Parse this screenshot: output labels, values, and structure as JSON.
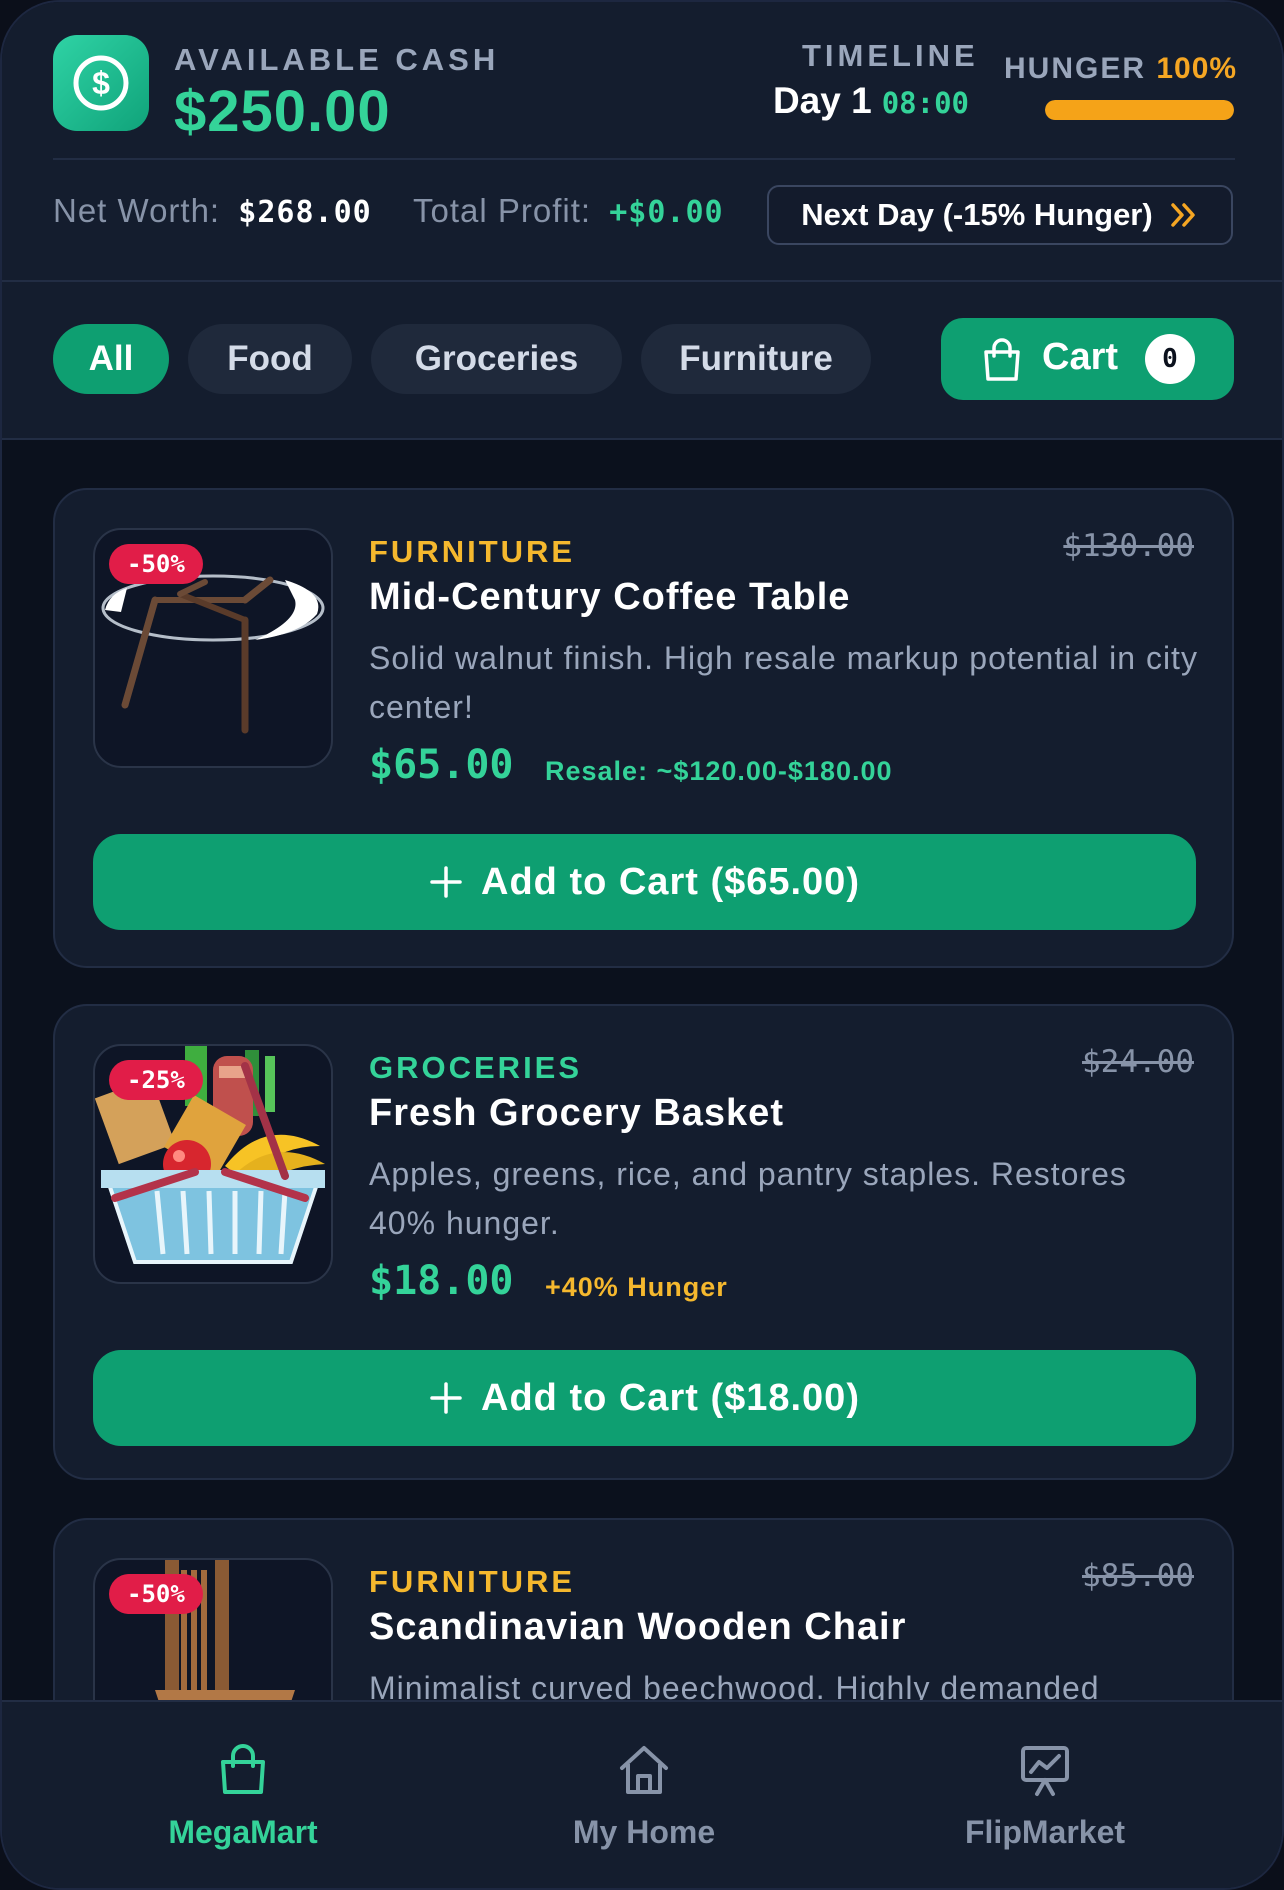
{
  "header": {
    "cash_label": "AVAILABLE CASH",
    "cash_value": "$250.00",
    "timeline_label": "TIMELINE",
    "day": "Day 1",
    "time": "08:00",
    "hunger_label": "HUNGER",
    "hunger_pct": "100%",
    "hunger_level": 1.0,
    "net_worth_label": "Net Worth:",
    "net_worth_value": "$268.00",
    "total_profit_label": "Total Profit:",
    "total_profit_value": "+$0.00",
    "next_day_label": "Next Day (-15% Hunger)"
  },
  "filters": {
    "tabs": [
      {
        "label": "All",
        "active": true
      },
      {
        "label": "Food",
        "active": false
      },
      {
        "label": "Groceries",
        "active": false
      },
      {
        "label": "Furniture",
        "active": false
      }
    ],
    "cart_label": "Cart",
    "cart_count": "0"
  },
  "products": [
    {
      "discount": "-50%",
      "category": "FURNITURE",
      "category_color": "#f5b82e",
      "old_price": "$130.00",
      "title": "Mid-Century Coffee Table",
      "description": "Solid walnut finish. High resale markup potential in city center!",
      "price": "$65.00",
      "note": "Resale: ~$120.00-$180.00",
      "note_color": "#34d399",
      "button": "Add to Cart ($65.00)",
      "image_icon": "coffee-table-image"
    },
    {
      "discount": "-25%",
      "category": "GROCERIES",
      "category_color": "#34d399",
      "old_price": "$24.00",
      "title": "Fresh Grocery Basket",
      "description": "Apples, greens, rice, and pantry staples. Restores 40% hunger.",
      "price": "$18.00",
      "note": "+40% Hunger",
      "note_color": "#f5b82e",
      "button": "Add to Cart ($18.00)",
      "image_icon": "grocery-basket-image"
    },
    {
      "discount": "-50%",
      "category": "FURNITURE",
      "category_color": "#f5b82e",
      "old_price": "$85.00",
      "title": "Scandinavian Wooden Chair",
      "description": "Minimalist curved beechwood. Highly demanded",
      "image_icon": "wooden-chair-image"
    }
  ],
  "bottom_nav": {
    "items": [
      {
        "label": "MegaMart",
        "icon": "shopping-bag-icon",
        "active": true
      },
      {
        "label": "My Home",
        "icon": "home-icon",
        "active": false
      },
      {
        "label": "FlipMarket",
        "icon": "chart-board-icon",
        "active": false
      }
    ]
  },
  "colors": {
    "accent": "#0e9f71",
    "accent_text": "#34d399",
    "warning": "#f5a623",
    "discount": "#e11d48",
    "background": "#0b111d",
    "panel": "#141d2e"
  }
}
